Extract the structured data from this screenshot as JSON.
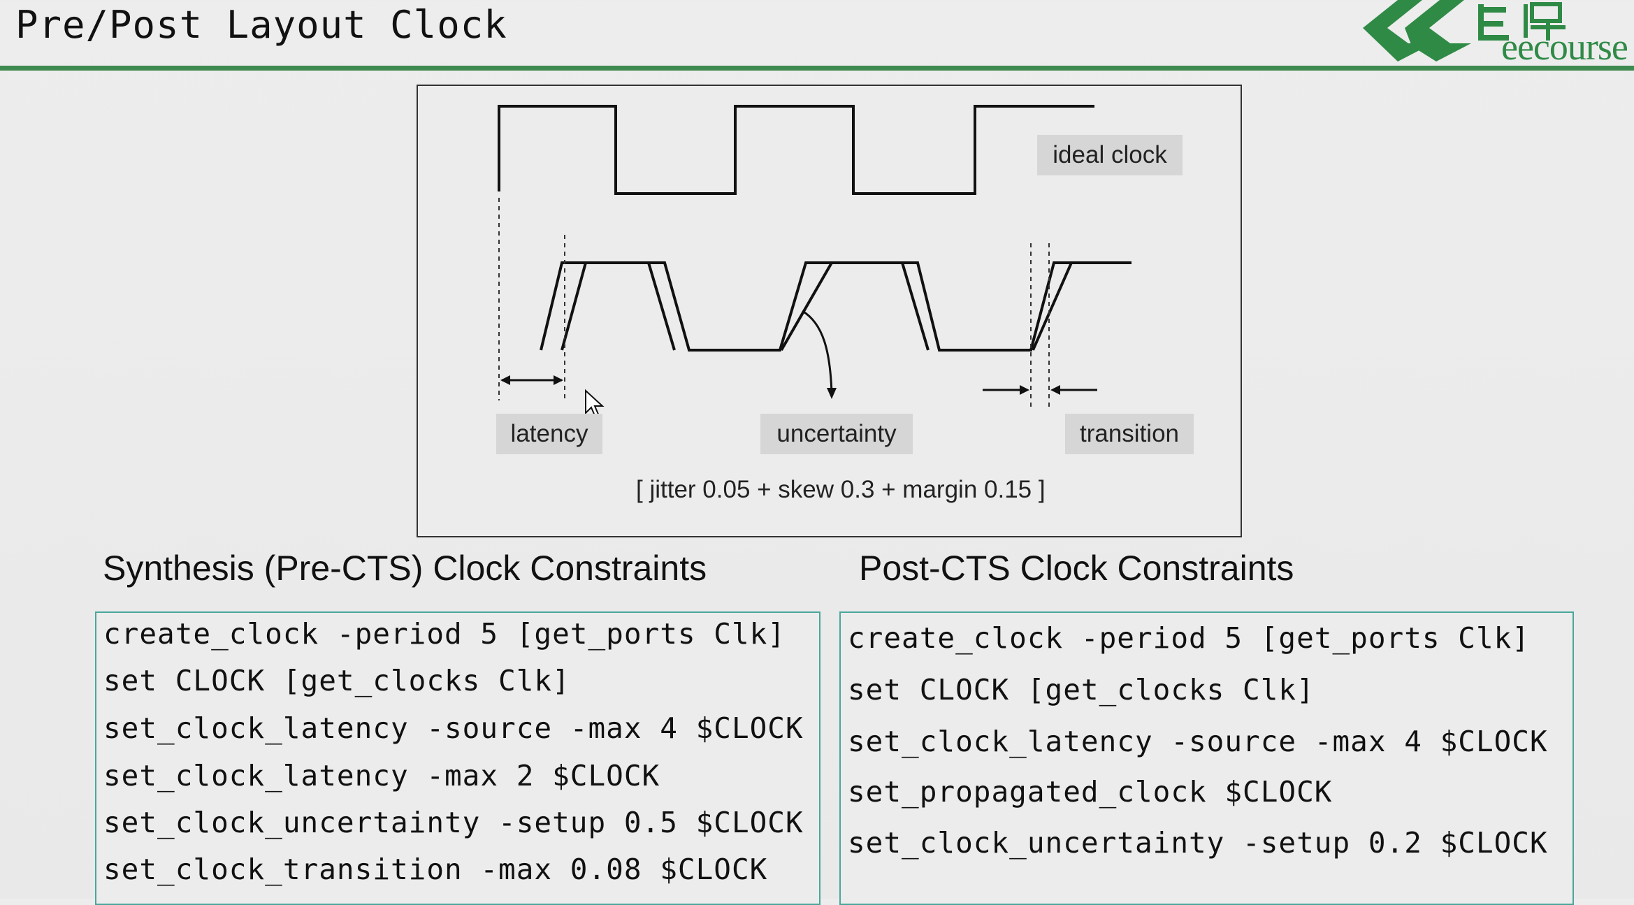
{
  "slide": {
    "title": "Pre/Post Layout Clock"
  },
  "logo": {
    "text": "E课 eecourse",
    "visible_text": "eecourse",
    "color": "#2f8a46"
  },
  "diagram": {
    "labels": {
      "ideal_clock": "ideal clock",
      "latency": "latency",
      "uncertainty": "uncertainty",
      "transition": "transition"
    },
    "formula": "[ jitter 0.05 + skew 0.3 + margin 0.15 ]"
  },
  "pre_cts": {
    "heading": "Synthesis (Pre-CTS) Clock Constraints",
    "lines": [
      "create_clock -period 5 [get_ports Clk]",
      "set CLOCK [get_clocks Clk]",
      "set_clock_latency -source -max 4 $CLOCK",
      "set_clock_latency -max 2 $CLOCK",
      "set_clock_uncertainty -setup 0.5 $CLOCK",
      "set_clock_transition -max 0.08 $CLOCK"
    ]
  },
  "post_cts": {
    "heading": "Post-CTS Clock Constraints",
    "lines": [
      "create_clock -period 5 [get_ports Clk]",
      "set CLOCK [get_clocks Clk]",
      "set_clock_latency -source -max 4 $CLOCK",
      "set_propagated_clock $CLOCK",
      "set_clock_uncertainty -setup 0.2 $CLOCK"
    ]
  },
  "colors": {
    "accent_rule": "#3f8a4f",
    "code_border": "#4aa69a"
  }
}
